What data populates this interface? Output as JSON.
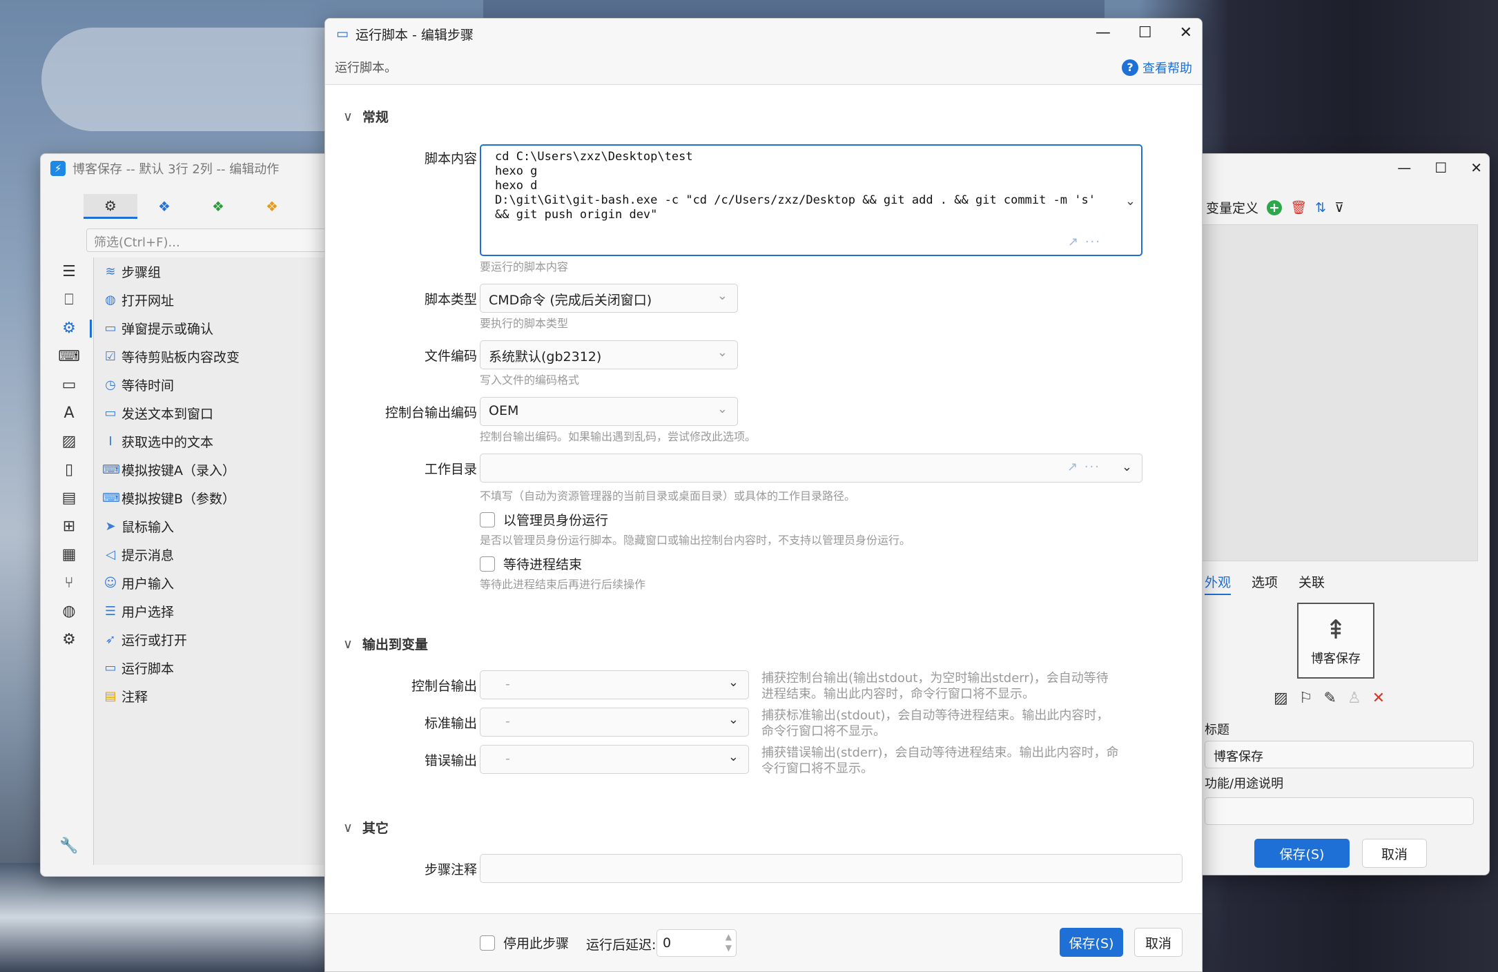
{
  "left_window": {
    "title": "博客保存 -- 默认 3行 2列 -- 编辑动作",
    "filter_placeholder": "筛选(Ctrl+F)...",
    "tabs": [
      {
        "icon": "gears-icon",
        "glyph": "⚙"
      },
      {
        "icon": "blue-cubes-icon",
        "glyph": "❖"
      },
      {
        "icon": "green-cubes-icon",
        "glyph": "❖"
      },
      {
        "icon": "orange-cubes-icon",
        "glyph": "❖"
      }
    ],
    "rail_icons": [
      "menu-icon",
      "bookmark-icon",
      "gear-icon",
      "keyboard-icon",
      "window-icon",
      "font-icon",
      "image-icon",
      "clipboard-icon",
      "document-icon",
      "windows-icon",
      "grid-icon",
      "branch-icon",
      "globe-icon",
      "gears-icon"
    ],
    "items": [
      {
        "label": "步骤组",
        "icon": "layers-icon"
      },
      {
        "label": "打开网址",
        "icon": "globe-icon"
      },
      {
        "label": "弹窗提示或确认",
        "icon": "dialog-icon"
      },
      {
        "label": "等待剪贴板内容改变",
        "icon": "clipboard-check-icon"
      },
      {
        "label": "等待时间",
        "icon": "clock-icon"
      },
      {
        "label": "发送文本到窗口",
        "icon": "message-icon"
      },
      {
        "label": "获取选中的文本",
        "icon": "text-cursor-icon"
      },
      {
        "label": "模拟按键A（录入）",
        "icon": "keyboard-icon"
      },
      {
        "label": "模拟按键B（参数）",
        "icon": "keyboard-icon"
      },
      {
        "label": "鼠标输入",
        "icon": "cursor-icon"
      },
      {
        "label": "提示消息",
        "icon": "megaphone-icon"
      },
      {
        "label": "用户输入",
        "icon": "user-edit-icon"
      },
      {
        "label": "用户选择",
        "icon": "list-icon"
      },
      {
        "label": "运行或打开",
        "icon": "send-icon"
      },
      {
        "label": "运行脚本",
        "icon": "script-icon"
      },
      {
        "label": "注释",
        "icon": "note-icon"
      }
    ]
  },
  "right_window": {
    "vars_label": "变量定义",
    "tabs": [
      "外观",
      "选项",
      "关联"
    ],
    "icon_label": "博客保存",
    "title_label": "标题",
    "title_value": "博客保存",
    "desc_label": "功能/用途说明",
    "desc_value": "",
    "save_label": "保存(S)",
    "cancel_label": "取消"
  },
  "dialog": {
    "title": "运行脚本 - 编辑步骤",
    "subtitle": "运行脚本。",
    "help_label": "查看帮助",
    "section_general": "常规",
    "script_label": "脚本内容",
    "script_content": "cd C:\\Users\\zxz\\Desktop\\test\nhexo g\nhexo d\nD:\\git\\Git\\git-bash.exe -c \"cd /c/Users/zxz/Desktop && git add . && git commit -m 's' && git push origin dev\"",
    "script_hint": "要运行的脚本内容",
    "type_label": "脚本类型",
    "type_value": "CMD命令 (完成后关闭窗口)",
    "type_hint": "要执行的脚本类型",
    "encoding_label": "文件编码",
    "encoding_value": "系统默认(gb2312)",
    "encoding_hint": "写入文件的编码格式",
    "console_enc_label": "控制台输出编码",
    "console_enc_value": "OEM",
    "console_enc_hint": "控制台输出编码。如果输出遇到乱码，尝试修改此选项。",
    "workdir_label": "工作目录",
    "workdir_value": "",
    "workdir_hint": "不填写（自动为资源管理器的当前目录或桌面目录）或具体的工作目录路径。",
    "admin_label": "以管理员身份运行",
    "admin_hint": "是否以管理员身份运行脚本。隐藏窗口或输出控制台内容时，不支持以管理员身份运行。",
    "wait_label": "等待进程结束",
    "wait_hint": "等待此进程结束后再进行后续操作",
    "section_output": "输出到变量",
    "console_out_label": "控制台输出",
    "console_out_value": "-",
    "console_out_hint": "捕获控制台输出(输出stdout，为空时输出stderr)，会自动等待进程结束。输出此内容时，命令行窗口将不显示。",
    "stdout_label": "标准输出",
    "stdout_value": "-",
    "stdout_hint": "捕获标准输出(stdout)，会自动等待进程结束。输出此内容时，命令行窗口将不显示。",
    "stderr_label": "错误输出",
    "stderr_value": "-",
    "stderr_hint": "捕获错误输出(stderr)，会自动等待进程结束。输出此内容时，命令行窗口将不显示。",
    "section_other": "其它",
    "note_label": "步骤注释",
    "note_value": "",
    "disable_label": "停用此步骤",
    "delay_label": "运行后延迟:",
    "delay_value": "0",
    "save_label": "保存(S)",
    "cancel_label": "取消"
  }
}
